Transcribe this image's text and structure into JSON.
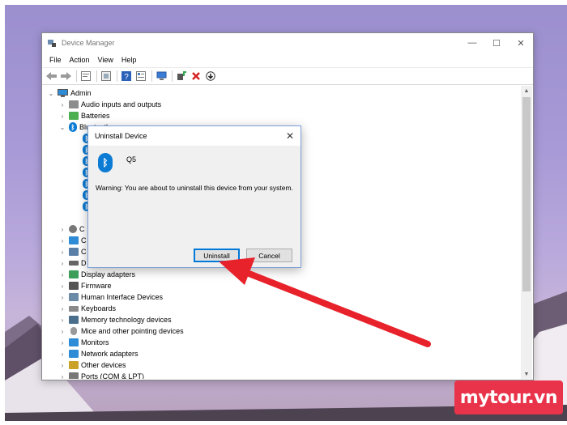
{
  "window": {
    "title": "Device Manager",
    "controls": {
      "minimize": "—",
      "maximize": "☐",
      "close": "✕"
    }
  },
  "menu": [
    "File",
    "Action",
    "View",
    "Help"
  ],
  "toolbar": [
    "back-icon",
    "forward-icon",
    "properties-icon",
    "update-icon",
    "help-icon",
    "details-icon",
    "scan-icon",
    "add-driver-icon",
    "uninstall-icon",
    "download-icon"
  ],
  "tree": {
    "root": "Admin",
    "items": [
      {
        "label": "Audio inputs and outputs",
        "chev": "›",
        "icon": "speaker-icon",
        "color": "#8c8c8c"
      },
      {
        "label": "Batteries",
        "chev": "›",
        "icon": "battery-icon",
        "color": "#4caf50"
      },
      {
        "label": "Bluetooth",
        "chev": "⌄",
        "icon": "bluetooth-icon",
        "color": "#0b7bd4"
      },
      {
        "label": "C",
        "chev": "›",
        "icon": "camera-icon",
        "color": "#777777"
      },
      {
        "label": "C",
        "chev": "›",
        "icon": "computer-icon",
        "color": "#2e8bd6"
      },
      {
        "label": "C",
        "chev": "›",
        "icon": "controller-icon",
        "color": "#5a7fa6"
      },
      {
        "label": "D",
        "chev": "›",
        "icon": "disk-icon",
        "color": "#666666"
      },
      {
        "label": "Display adapters",
        "chev": "›",
        "icon": "display-icon",
        "color": "#3d9e5a"
      },
      {
        "label": "Firmware",
        "chev": "›",
        "icon": "firmware-icon",
        "color": "#555555"
      },
      {
        "label": "Human Interface Devices",
        "chev": "›",
        "icon": "hid-icon",
        "color": "#6c8ba6"
      },
      {
        "label": "Keyboards",
        "chev": "›",
        "icon": "keyboard-icon",
        "color": "#8a8a8a"
      },
      {
        "label": "Memory technology devices",
        "chev": "›",
        "icon": "memory-icon",
        "color": "#4a6f8c"
      },
      {
        "label": "Mice and other pointing devices",
        "chev": "›",
        "icon": "mouse-icon",
        "color": "#9a9a9a"
      },
      {
        "label": "Monitors",
        "chev": "›",
        "icon": "monitor-icon",
        "color": "#2e8bd6"
      },
      {
        "label": "Network adapters",
        "chev": "›",
        "icon": "network-icon",
        "color": "#2e8bd6"
      },
      {
        "label": "Other devices",
        "chev": "›",
        "icon": "other-devices-icon",
        "color": "#c9a227"
      },
      {
        "label": "Ports (COM & LPT)",
        "chev": "›",
        "icon": "port-icon",
        "color": "#777777"
      }
    ]
  },
  "dialog": {
    "title": "Uninstall Device",
    "close": "✕",
    "device_name": "Q5",
    "warning": "Warning: You are about to uninstall this device from your system.",
    "uninstall_label": "Uninstall",
    "cancel_label": "Cancel"
  },
  "watermark": "mytour.vn",
  "colors": {
    "arrow": "#e8222b",
    "accent": "#0078d7",
    "bluetooth": "#0b7bd4",
    "brand": "#e8334a"
  }
}
